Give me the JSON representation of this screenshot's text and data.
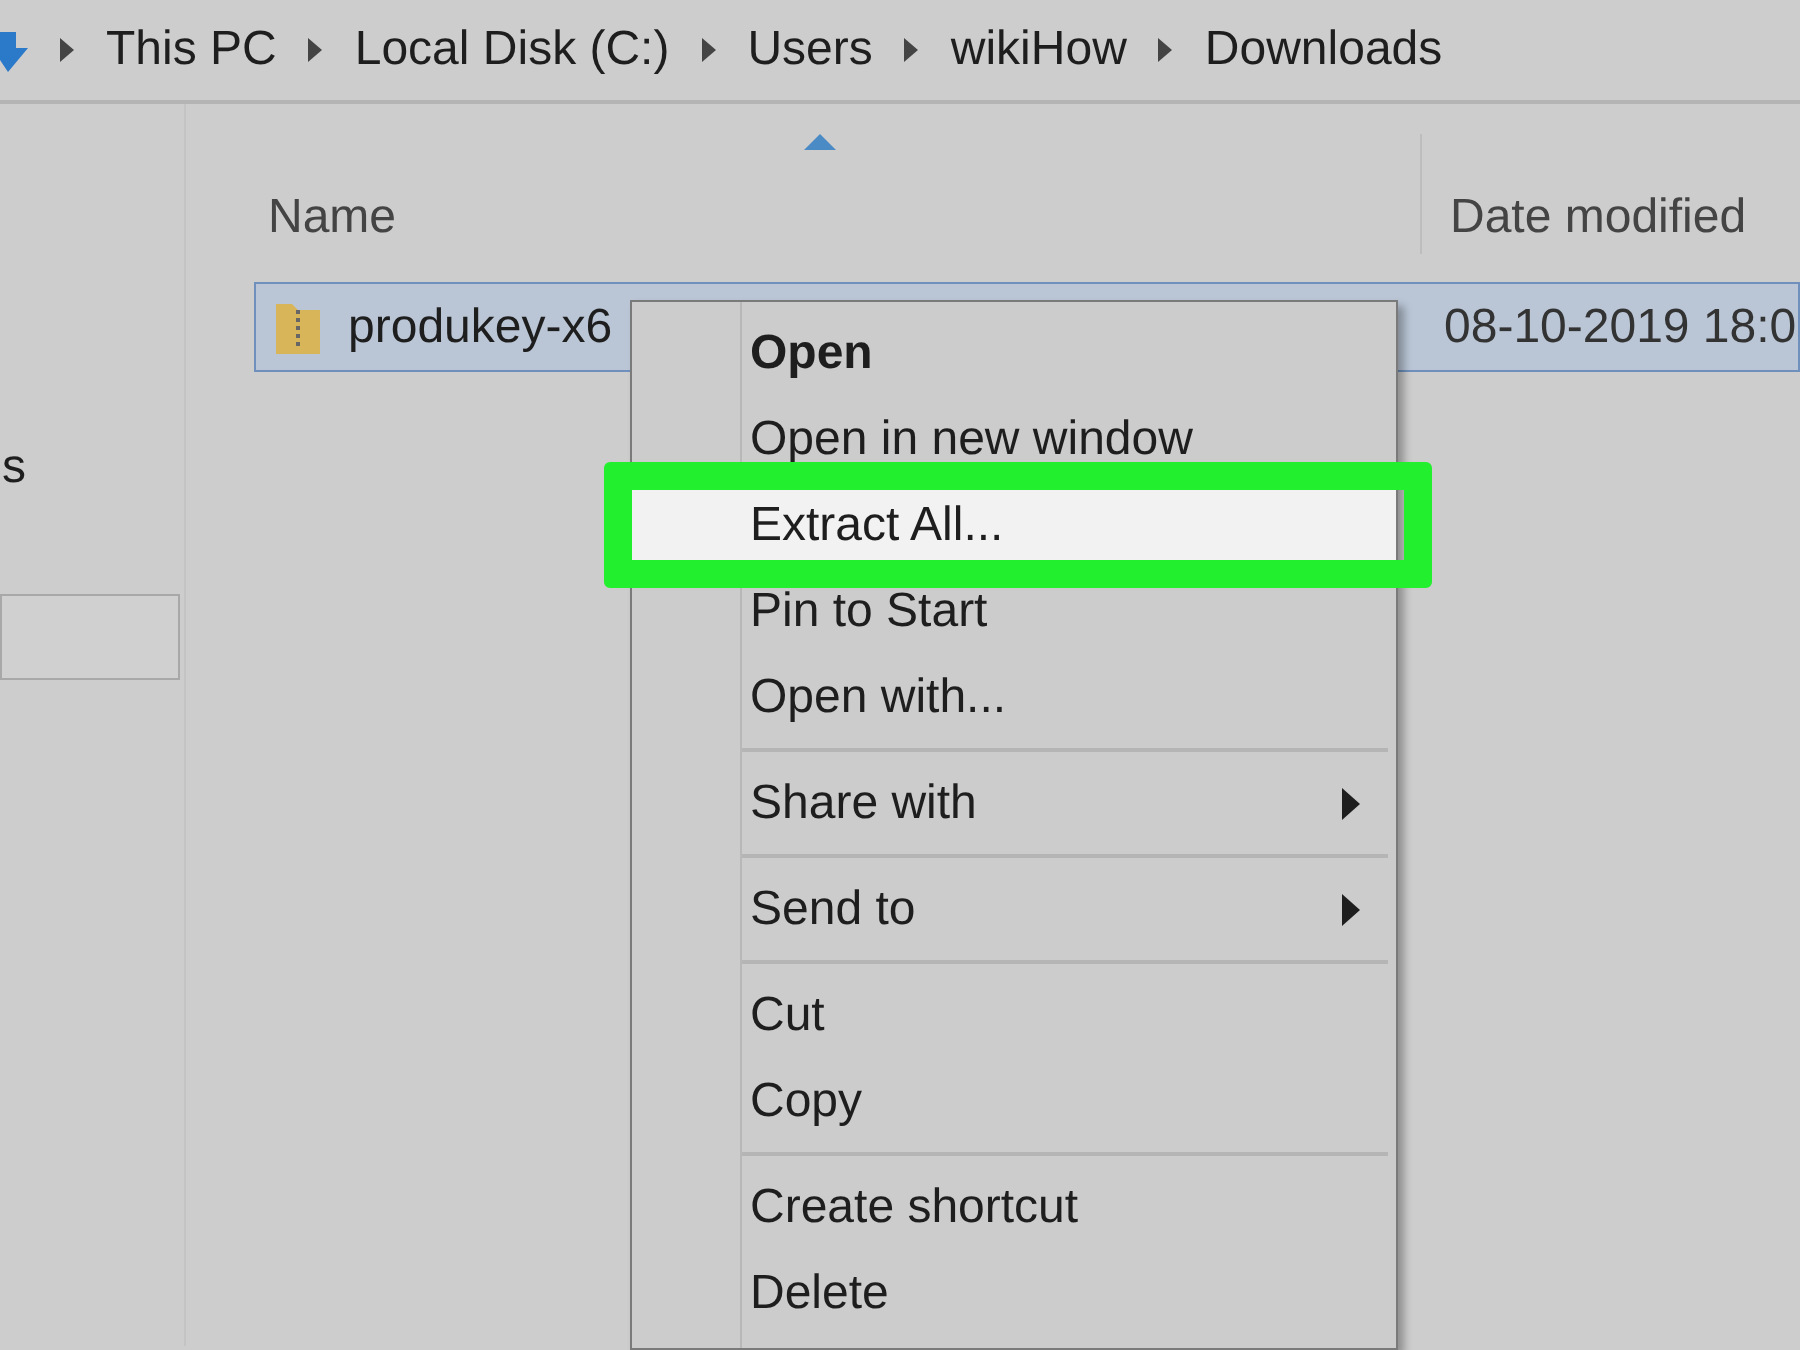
{
  "breadcrumb": [
    "This PC",
    "Local Disk (C:)",
    "Users",
    "wikiHow",
    "Downloads"
  ],
  "navigation": {
    "items": [
      {
        "label": "s",
        "selected": false
      },
      {
        "selected": true
      }
    ]
  },
  "file_list": {
    "columns": [
      {
        "label": "Name",
        "sorted": true
      },
      {
        "label": "Date modified",
        "sorted": false
      }
    ],
    "rows": [
      {
        "name": "produkey-x6",
        "date_modified": "08-10-2019 18:0",
        "selected": true
      }
    ]
  },
  "context_menu": {
    "groups": [
      {
        "items": [
          {
            "label": "Open",
            "default": true,
            "highlighted": false,
            "submenu": false
          },
          {
            "label": "Open in new window",
            "default": false,
            "highlighted": false,
            "submenu": false
          },
          {
            "label": "Extract All...",
            "default": false,
            "highlighted": true,
            "submenu": false
          },
          {
            "label": "Pin to Start",
            "default": false,
            "highlighted": false,
            "submenu": false
          },
          {
            "label": "Open with...",
            "default": false,
            "highlighted": false,
            "submenu": false
          }
        ]
      },
      {
        "items": [
          {
            "label": "Share with",
            "default": false,
            "highlighted": false,
            "submenu": true
          }
        ]
      },
      {
        "items": [
          {
            "label": "Send to",
            "default": false,
            "highlighted": false,
            "submenu": true
          }
        ]
      },
      {
        "items": [
          {
            "label": "Cut",
            "default": false,
            "highlighted": false,
            "submenu": false
          },
          {
            "label": "Copy",
            "default": false,
            "highlighted": false,
            "submenu": false
          }
        ]
      },
      {
        "items": [
          {
            "label": "Create shortcut",
            "default": false,
            "highlighted": false,
            "submenu": false
          },
          {
            "label": "Delete",
            "default": false,
            "highlighted": false,
            "submenu": false
          }
        ]
      }
    ]
  }
}
